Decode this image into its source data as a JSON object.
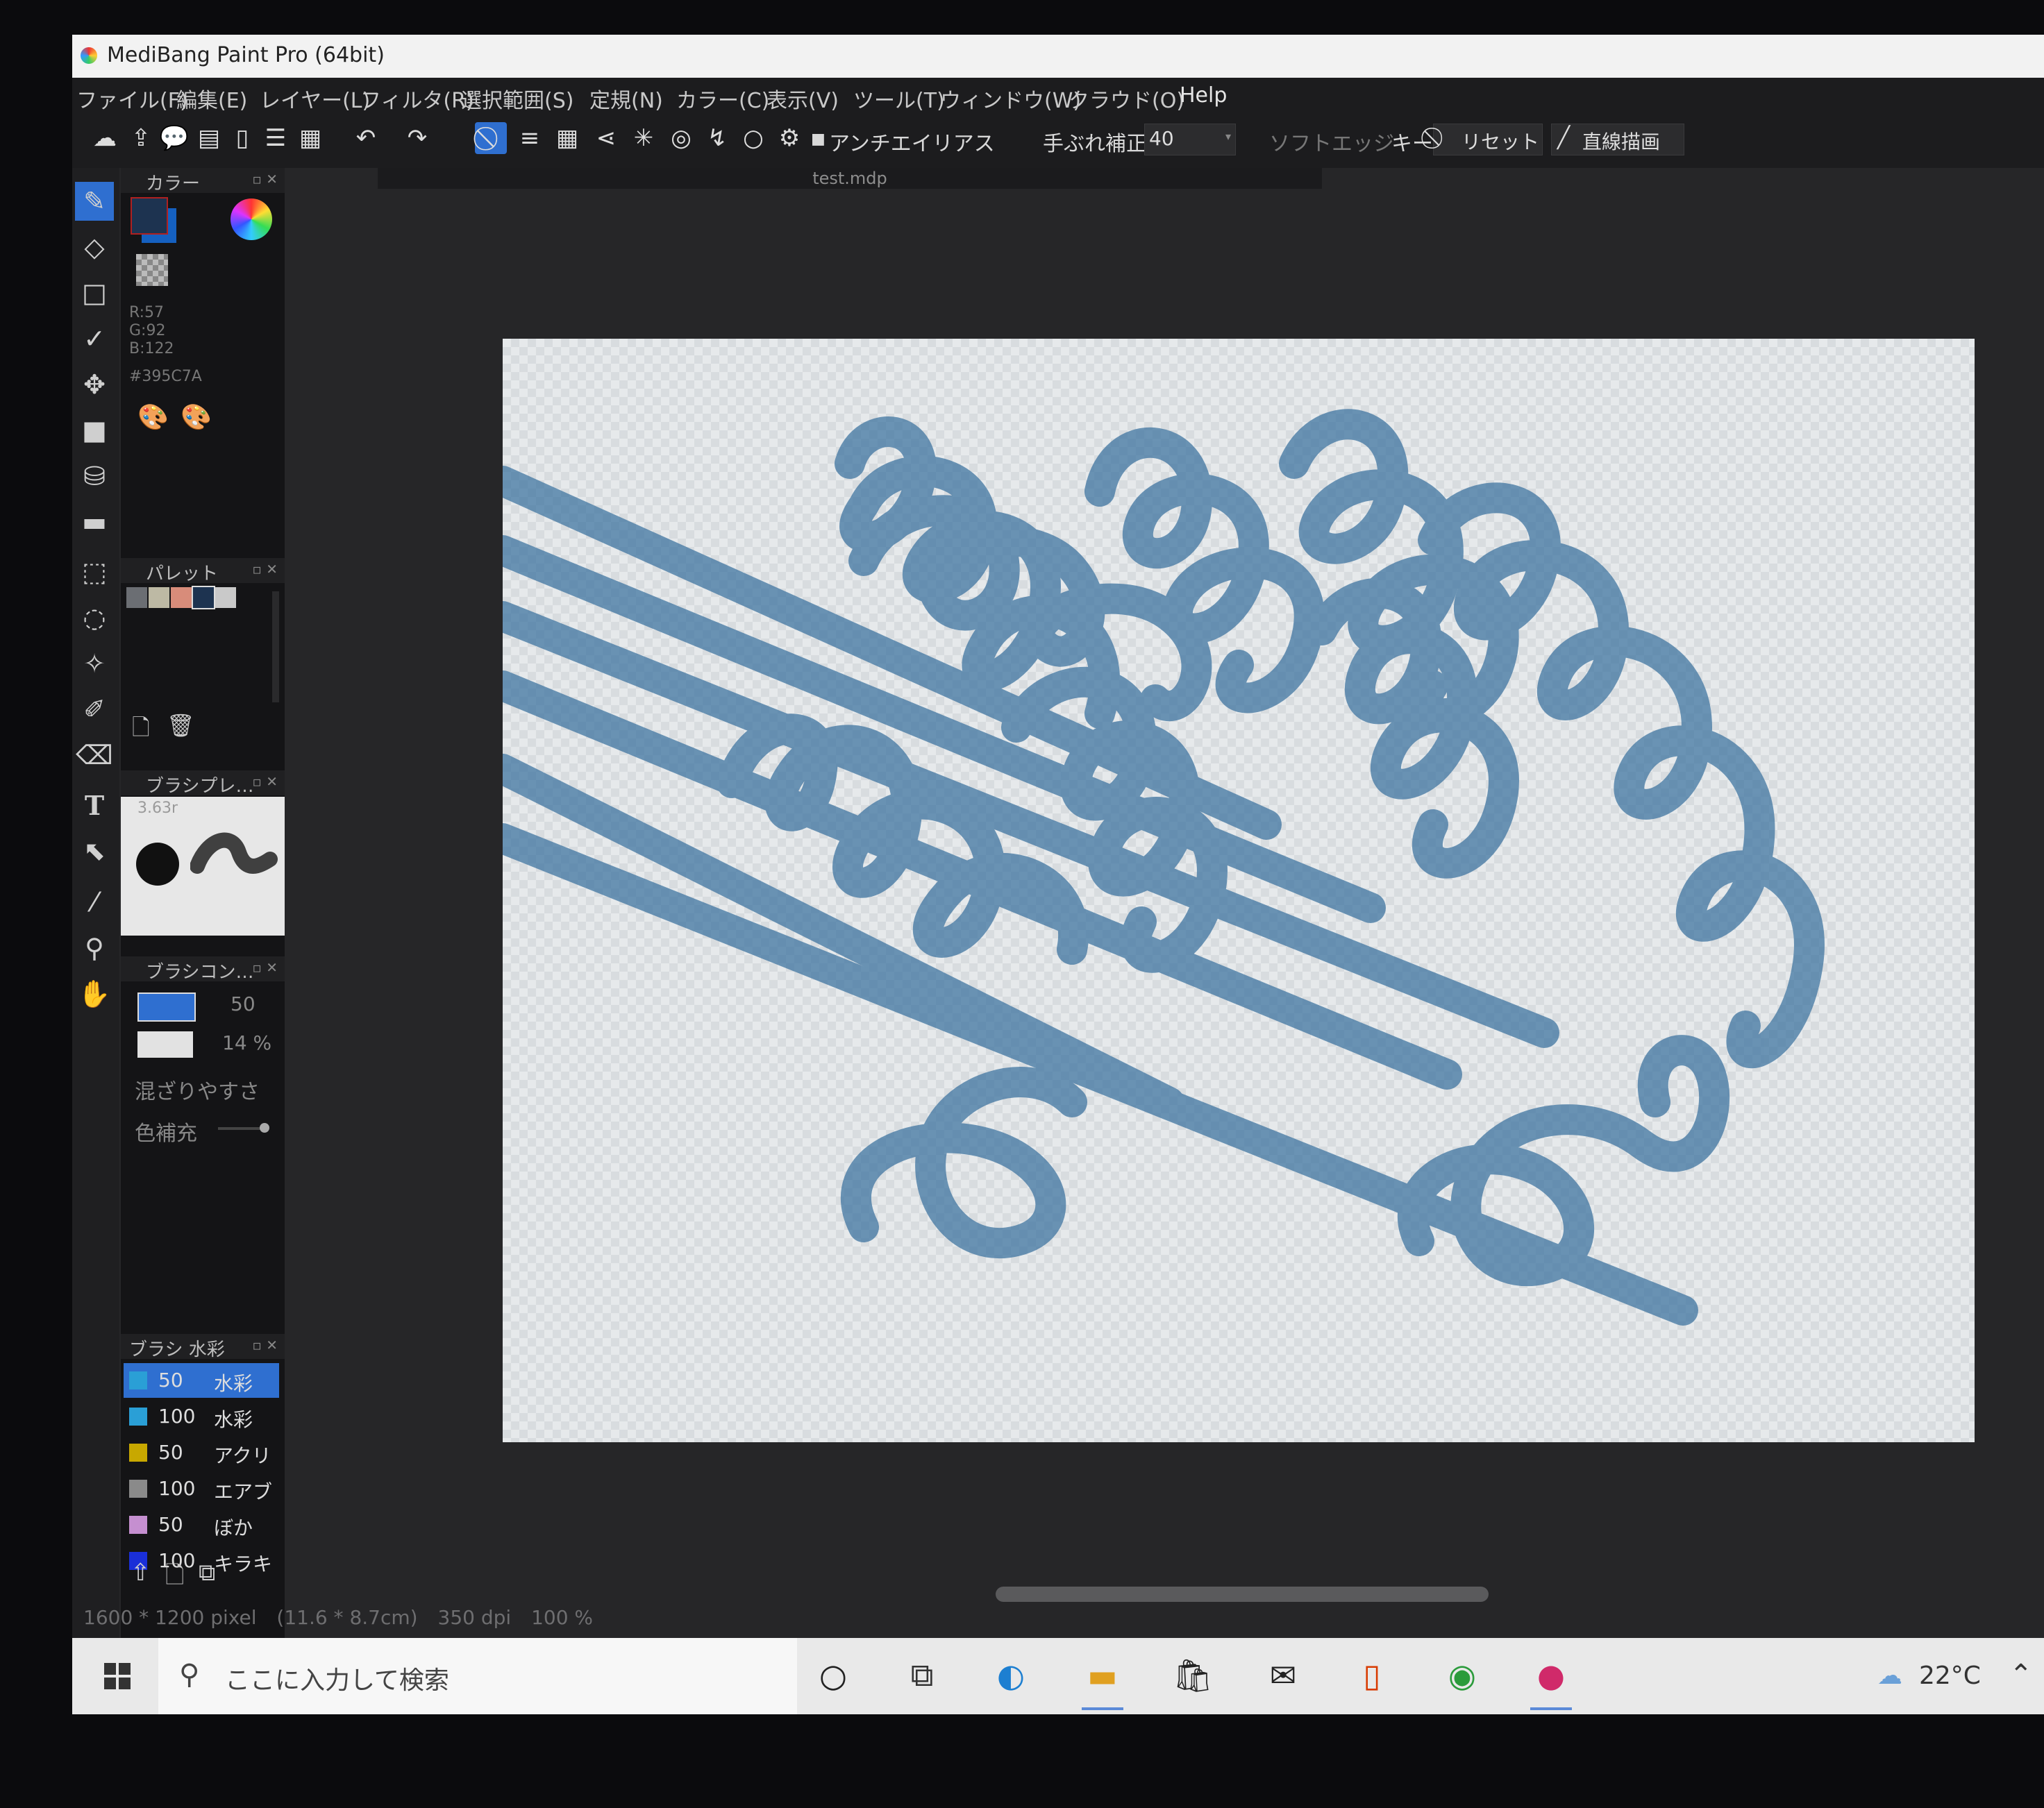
{
  "window": {
    "title": "MediBang Paint Pro (64bit)"
  },
  "menu": [
    "ファイル(F)",
    "編集(E)",
    "レイヤー(L)",
    "フィルタ(R)",
    "選択範囲(S)",
    "定規(N)",
    "カラー(C)",
    "表示(V)",
    "ツール(T)",
    "ウィンドウ(W)",
    "クラウド(O)",
    "Help"
  ],
  "toolbar": {
    "antialias": "アンチエイリアス",
    "stabilizer_label": "手ぶれ補正",
    "stabilizer_value": "40",
    "soft_edge": "ソフトエッジ",
    "key": "キー",
    "reset": "リセット",
    "line_draw": "直線描画"
  },
  "document": {
    "tab": "test.mdp"
  },
  "color_panel": {
    "title": "カラー",
    "r": "R:57",
    "g": "G:92",
    "b": "B:122",
    "hex": "#395C7A",
    "foreground": "#1d3350",
    "background": "#1560c0"
  },
  "palette_panel": {
    "title": "パレット",
    "swatches": [
      "#6b6e73",
      "#bdb9a4",
      "#d88c7a",
      "#1d3350",
      "#c9c9c9"
    ]
  },
  "brush_preview_panel": {
    "title": "ブラシプレ…",
    "size": "3.63r"
  },
  "brush_control_panel": {
    "title": "ブラシコン…",
    "size_value": "50",
    "opacity_value": "14 %",
    "blend_label": "混ざりやすさ",
    "refill_label": "色補充"
  },
  "brush_list_panel": {
    "title": "ブラシ 水彩",
    "items": [
      {
        "size": "50",
        "name": "水彩",
        "color": "#2a9fd6",
        "selected": true
      },
      {
        "size": "100",
        "name": "水彩",
        "color": "#2a9fd6",
        "selected": false
      },
      {
        "size": "50",
        "name": "アクリ",
        "color": "#c8a800",
        "selected": false
      },
      {
        "size": "100",
        "name": "エアブ",
        "color": "#8a8a8a",
        "selected": false
      },
      {
        "size": "50",
        "name": "ぼか",
        "color": "#c58fd0",
        "selected": false
      },
      {
        "size": "100",
        "name": "キラキ",
        "color": "#1a2fd8",
        "selected": false
      }
    ]
  },
  "status": {
    "pixels": "1600 * 1200 pixel",
    "cm": "(11.6 * 8.7cm)",
    "dpi": "350 dpi",
    "zoom": "100 %"
  },
  "taskbar": {
    "search_placeholder": "ここに入力して検索",
    "temperature": "22°C"
  },
  "stroke_color": "#2f6a9a",
  "accent": "#2f6fd0"
}
